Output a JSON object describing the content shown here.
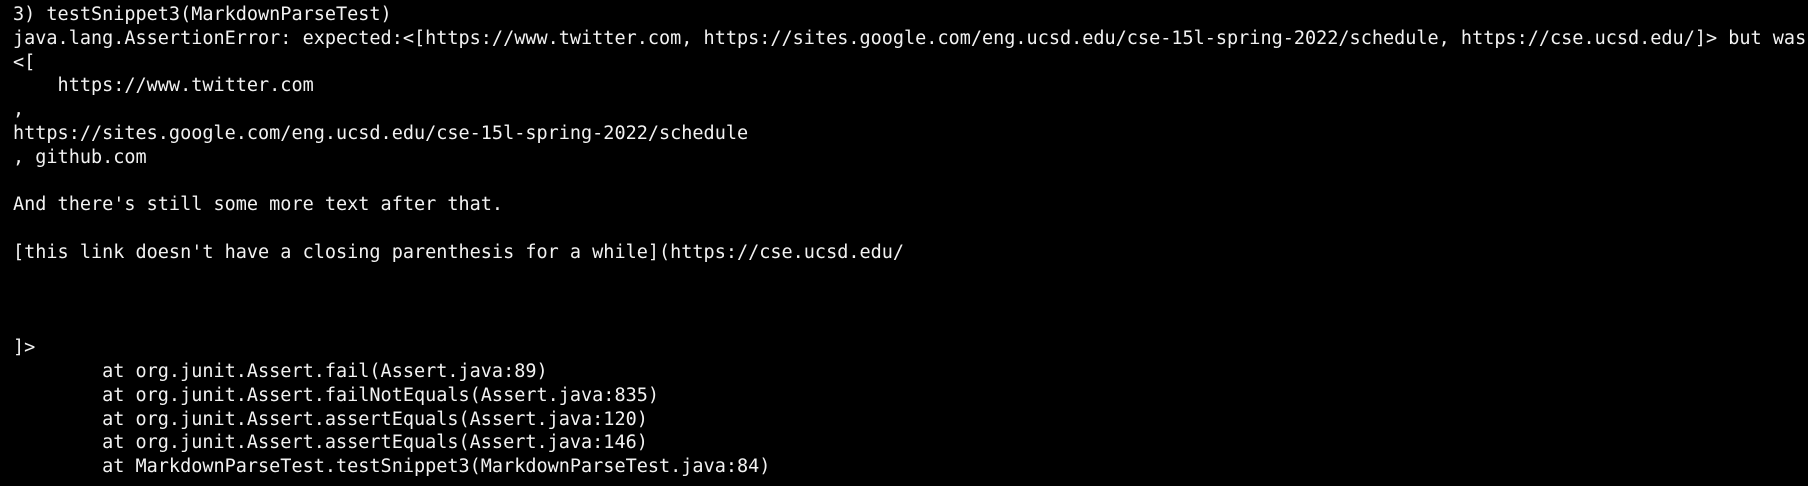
{
  "terminal": {
    "lines": [
      "3) testSnippet3(MarkdownParseTest)",
      "java.lang.AssertionError: expected:<[https://www.twitter.com, https://sites.google.com/eng.ucsd.edu/cse-15l-spring-2022/schedule, https://cse.ucsd.edu/]> but was:",
      "<[",
      "    https://www.twitter.com",
      ",",
      "https://sites.google.com/eng.ucsd.edu/cse-15l-spring-2022/schedule",
      ", github.com",
      "",
      "And there's still some more text after that.",
      "",
      "[this link doesn't have a closing parenthesis for a while](https://cse.ucsd.edu/",
      "",
      "",
      "",
      "]>",
      "        at org.junit.Assert.fail(Assert.java:89)",
      "        at org.junit.Assert.failNotEquals(Assert.java:835)",
      "        at org.junit.Assert.assertEquals(Assert.java:120)",
      "        at org.junit.Assert.assertEquals(Assert.java:146)",
      "        at MarkdownParseTest.testSnippet3(MarkdownParseTest.java:84)"
    ]
  }
}
